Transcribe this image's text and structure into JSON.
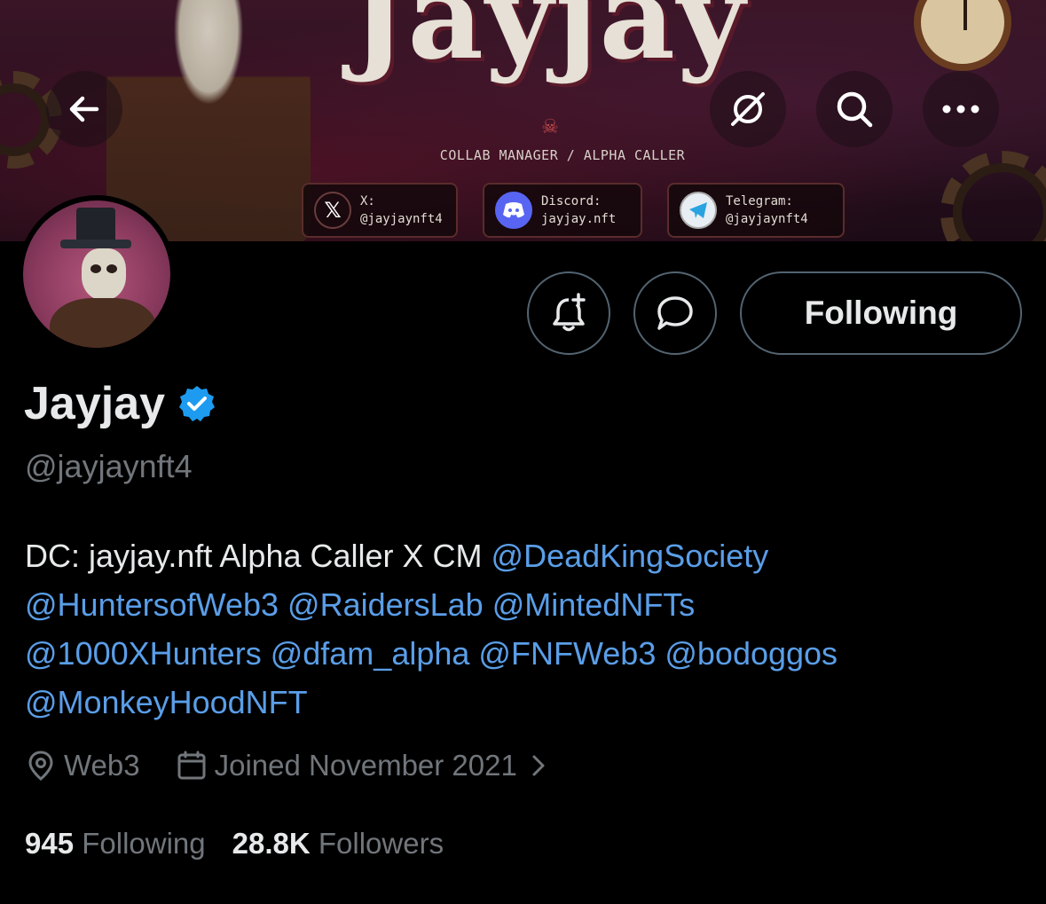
{
  "banner": {
    "title": "Jayjay",
    "subtitle": "COLLAB MANAGER / ALPHA CALLER",
    "socials": [
      {
        "icon": "x-icon",
        "text": "X:\n@jayjaynft4"
      },
      {
        "icon": "discord-icon",
        "text": "Discord:\njayjay.nft"
      },
      {
        "icon": "telegram-icon",
        "text": "Telegram:\n@jayjaynft4"
      }
    ]
  },
  "header_icons": {
    "back": "arrow-left-icon",
    "grok": "slash-circle-icon",
    "search": "search-icon",
    "more": "more-icon"
  },
  "actions": {
    "notify_icon": "bell-plus-icon",
    "message_icon": "message-bubble-icon",
    "follow_label": "Following"
  },
  "profile": {
    "display_name": "Jayjay",
    "verified": true,
    "handle": "@jayjaynft4",
    "bio_prefix": "DC: jayjay.nft Alpha Caller X CM",
    "mentions": [
      "@DeadKingSociety",
      "@HuntersofWeb3",
      "@RaidersLab",
      "@MintedNFTs",
      "@1000XHunters",
      "@dfam_alpha",
      "@FNFWeb3",
      "@bodoggos",
      "@MonkeyHoodNFT"
    ],
    "location": "Web3",
    "joined": "Joined November 2021",
    "following_count": "945",
    "following_label": "Following",
    "followers_count": "28.8K",
    "followers_label": "Followers"
  },
  "colors": {
    "background": "#000000",
    "text": "#e7e9ea",
    "muted": "#71767b",
    "link": "#5a9ee8",
    "verified": "#1d9bf0",
    "border": "#536471"
  }
}
